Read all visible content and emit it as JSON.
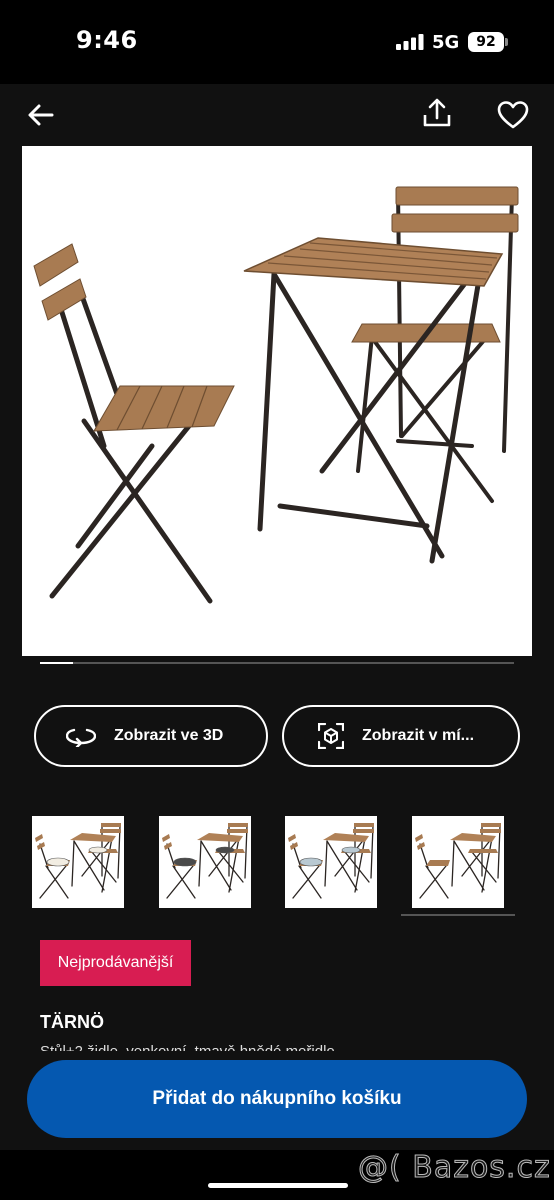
{
  "status_bar": {
    "time": "9:46",
    "network": "5G",
    "battery": "92"
  },
  "nav": {
    "back_icon": "arrow-left-icon",
    "share_icon": "share-icon",
    "favorite_icon": "heart-icon"
  },
  "gallery": {
    "progress": 0.07
  },
  "actions": {
    "view_3d_label": "Zobrazit ve 3D",
    "view_in_room_label": "Zobrazit v mí..."
  },
  "variants": [
    {
      "cushion": "#f2ede2"
    },
    {
      "cushion": "#4a4a4a"
    },
    {
      "cushion": "#b9c9d2"
    },
    {
      "cushion": "none"
    }
  ],
  "product": {
    "badge": "Nejprodávanější",
    "name": "TÄRNÖ",
    "description": "Stůl+2 židle, venkovní, tmavě hnědé mořidlo"
  },
  "cart_button_label": "Přidat do nákupního košíku",
  "watermark": "@( Bazos.cz",
  "colors": {
    "accent": "#0558b0",
    "badge": "#d81d52",
    "background": "#111111"
  }
}
